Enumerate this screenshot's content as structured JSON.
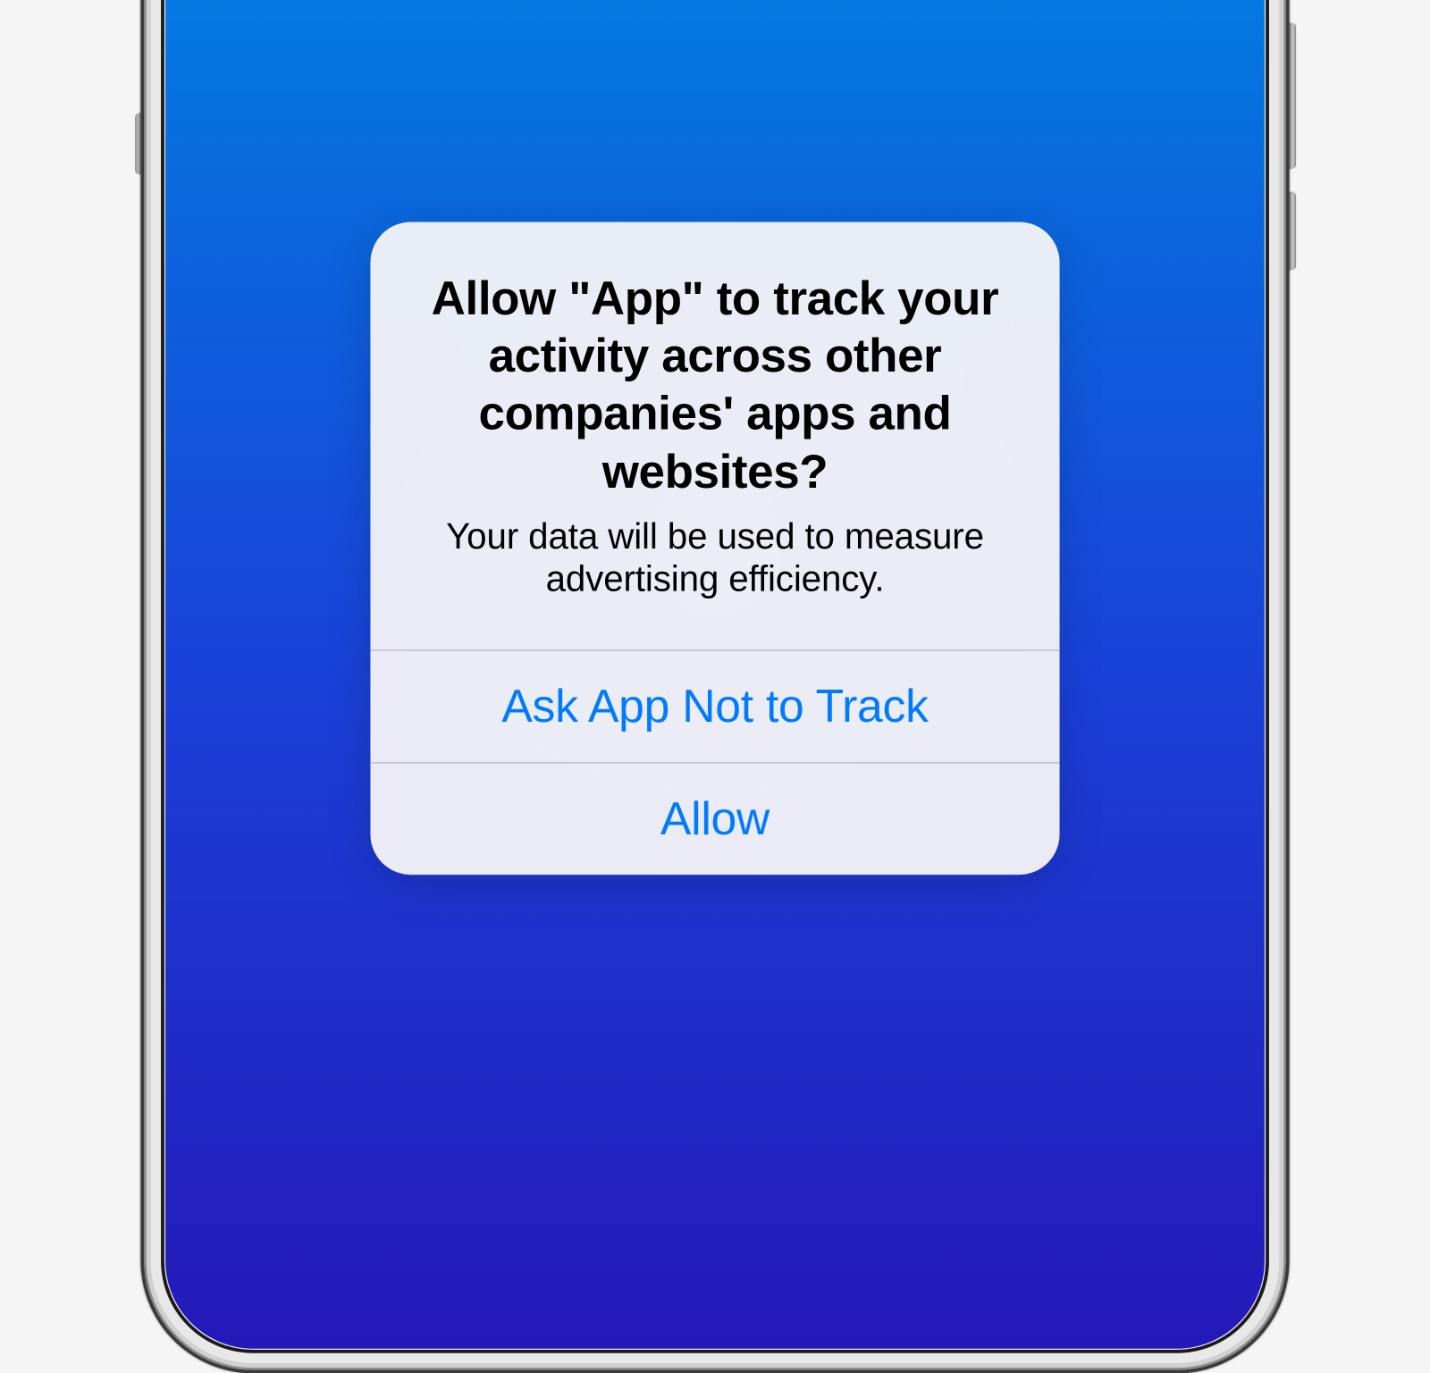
{
  "alert": {
    "title": "Allow \"App\" to track your activity across other companies' apps and websites?",
    "message": "Your data will be used to measure advertising efficiency.",
    "deny_label": "Ask App Not to Track",
    "allow_label": "Allow"
  }
}
